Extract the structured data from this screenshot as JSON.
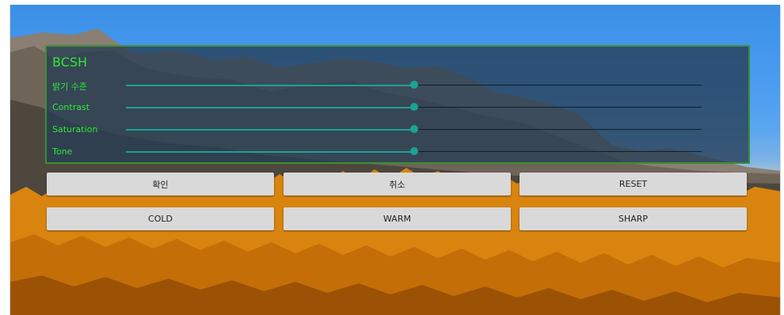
{
  "panel": {
    "title": "BCSH",
    "sliders": [
      {
        "label": "밝기 수준",
        "value": 0.5
      },
      {
        "label": "Contrast",
        "value": 0.5
      },
      {
        "label": "Saturation",
        "value": 0.5
      },
      {
        "label": "Tone",
        "value": 0.5
      }
    ]
  },
  "buttons": {
    "confirm": "확인",
    "cancel": "취소",
    "reset": "RESET",
    "cold": "COLD",
    "warm": "WARM",
    "sharp": "SHARP"
  },
  "colors": {
    "accent_text": "#2eea34",
    "slider": "#1aa394",
    "panel_border": "#3e8f33"
  }
}
